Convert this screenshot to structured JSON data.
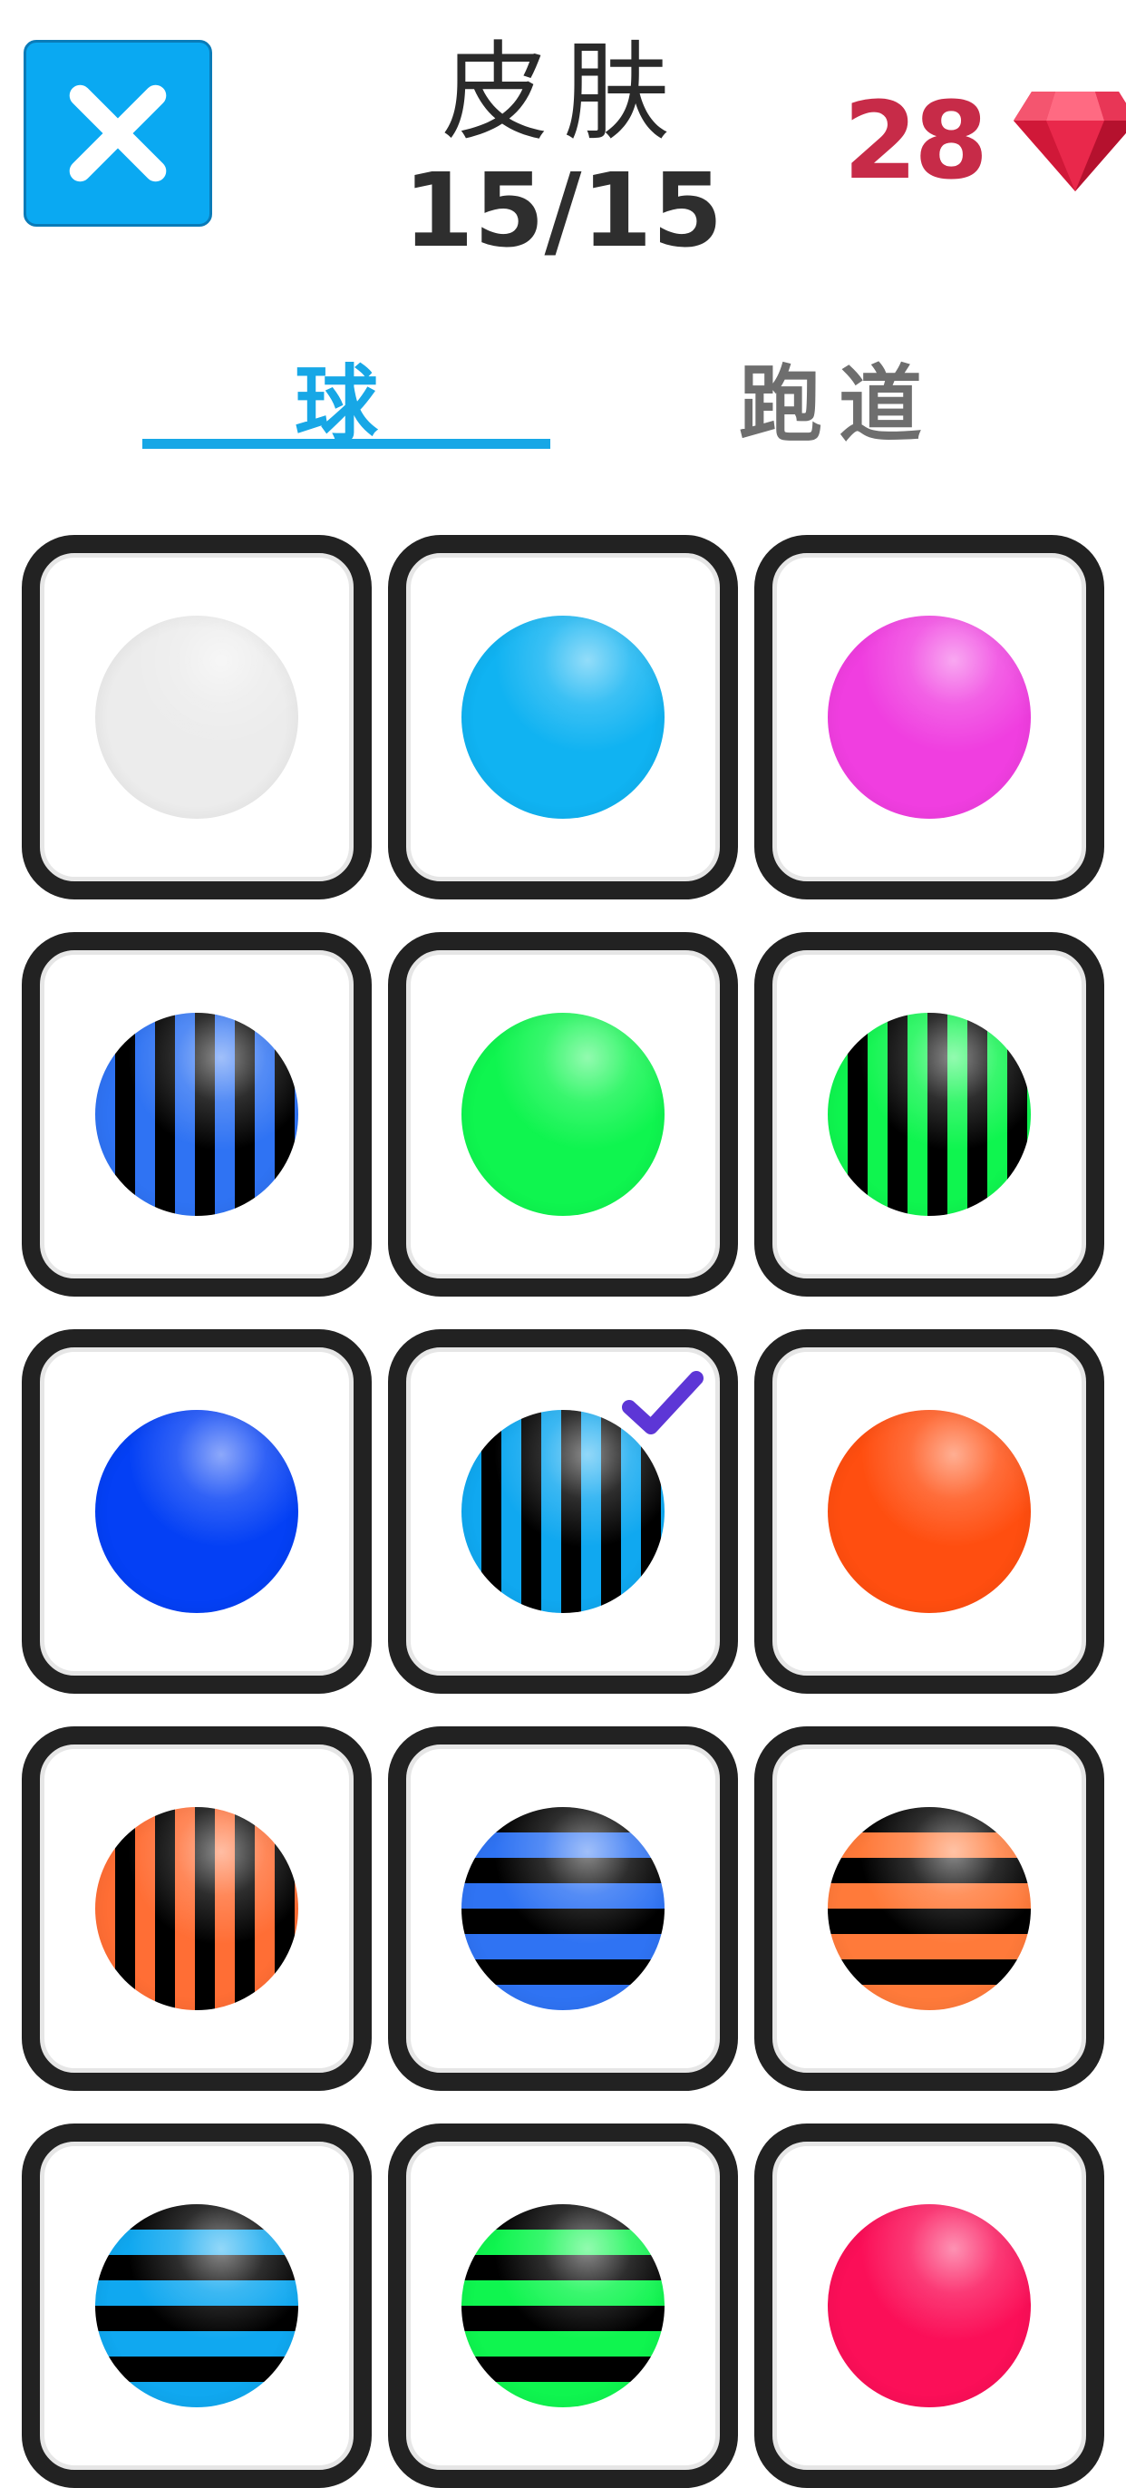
{
  "header": {
    "title": "皮肤",
    "count": "15/15",
    "gems": "28",
    "close_icon": "close-icon",
    "gem_icon": "ruby-gem-icon",
    "colors": {
      "close_bg": "#0aa9f2",
      "gem": "#d8203f",
      "count": "#c72b48"
    }
  },
  "tabs": [
    {
      "label": "球",
      "active": true
    },
    {
      "label": "跑道",
      "active": false
    }
  ],
  "selected_index": 7,
  "check_icon": "check-icon",
  "skins": [
    {
      "name": "white",
      "pattern": "solid",
      "colors": [
        "#ececec"
      ]
    },
    {
      "name": "cyan",
      "pattern": "solid",
      "colors": [
        "#10b3f2"
      ]
    },
    {
      "name": "magenta",
      "pattern": "solid",
      "colors": [
        "#f03ee0"
      ]
    },
    {
      "name": "blue-vertical",
      "pattern": "vertical",
      "colors": [
        "#2f73f3",
        "#000000"
      ]
    },
    {
      "name": "green",
      "pattern": "solid",
      "colors": [
        "#0ff54f"
      ]
    },
    {
      "name": "green-vertical",
      "pattern": "vertical",
      "colors": [
        "#0ff54f",
        "#000000"
      ]
    },
    {
      "name": "royal-blue",
      "pattern": "solid",
      "colors": [
        "#0440f5"
      ]
    },
    {
      "name": "cyan-vertical",
      "pattern": "vertical",
      "colors": [
        "#10a8f0",
        "#000000"
      ]
    },
    {
      "name": "orange",
      "pattern": "solid",
      "colors": [
        "#ff4e10"
      ]
    },
    {
      "name": "orange-vertical",
      "pattern": "vertical",
      "colors": [
        "#ff6e35",
        "#000000"
      ]
    },
    {
      "name": "blue-horizontal",
      "pattern": "horizontal",
      "colors": [
        "#2f73f3",
        "#000000"
      ]
    },
    {
      "name": "orange-horizontal",
      "pattern": "horizontal",
      "colors": [
        "#ff7a3a",
        "#000000"
      ]
    },
    {
      "name": "cyan-horizontal",
      "pattern": "horizontal",
      "colors": [
        "#10a8f0",
        "#000000"
      ]
    },
    {
      "name": "green-horizontal",
      "pattern": "horizontal",
      "colors": [
        "#0ff54f",
        "#000000"
      ]
    },
    {
      "name": "crimson",
      "pattern": "solid",
      "colors": [
        "#fb0f58"
      ]
    }
  ]
}
